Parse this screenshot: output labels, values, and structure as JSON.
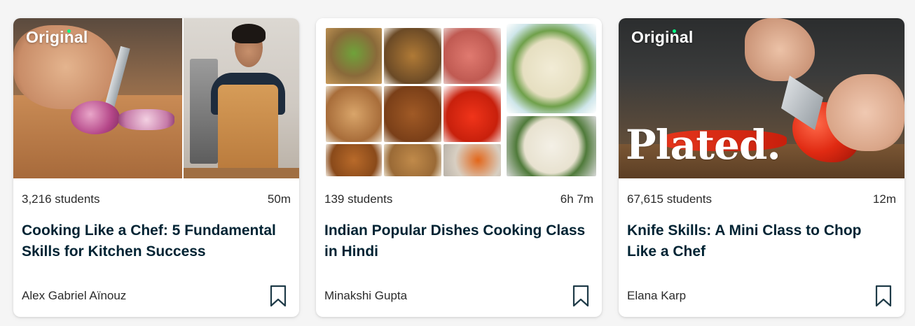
{
  "cards": [
    {
      "badge": "Original",
      "students": "3,216 students",
      "duration": "50m",
      "title": "Cooking Like a Chef: 5 Fundamental Skills for Kitchen Success",
      "author": "Alex Gabriel Aïnouz"
    },
    {
      "students": "139 students",
      "duration": "6h 7m",
      "title": "Indian Popular Dishes Cooking Class in Hindi",
      "author": "Minakshi Gupta"
    },
    {
      "badge": "Original",
      "thumb_logo": "Plated.",
      "students": "67,615 students",
      "duration": "12m",
      "title": "Knife Skills: A Mini Class to Chop Like a Chef",
      "author": "Elana Karp"
    }
  ],
  "icons": {
    "save": "bookmark-icon"
  },
  "colors": {
    "title": "#002333",
    "badge_dot": "#00ff84",
    "background": "#f5f5f5"
  }
}
